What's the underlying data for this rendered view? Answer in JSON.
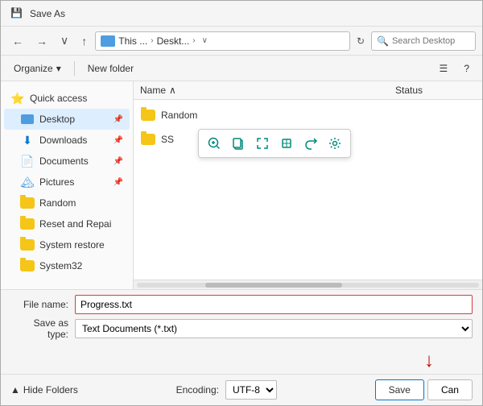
{
  "window": {
    "title": "Save As",
    "icon": "💾"
  },
  "navbar": {
    "back_label": "←",
    "forward_label": "→",
    "down_label": "∨",
    "up_label": "↑",
    "refresh_label": "↻",
    "address_parts": [
      "This ...",
      "Deskt...",
      ">"
    ],
    "search_placeholder": "Search Desktop"
  },
  "toolbar": {
    "organize_label": "Organize",
    "organize_arrow": "▾",
    "new_folder_label": "New folder",
    "view_icon": "☰",
    "help_icon": "?"
  },
  "sidebar": {
    "items": [
      {
        "id": "quick-access",
        "label": "Quick access",
        "icon": "⭐",
        "type": "header"
      },
      {
        "id": "desktop",
        "label": "Desktop",
        "icon": "desktop",
        "type": "item",
        "active": true,
        "pinned": true
      },
      {
        "id": "downloads",
        "label": "Downloads",
        "icon": "download",
        "type": "item",
        "pinned": true
      },
      {
        "id": "documents",
        "label": "Documents",
        "icon": "doc",
        "type": "item",
        "pinned": true
      },
      {
        "id": "pictures",
        "label": "Pictures",
        "icon": "pic",
        "type": "item",
        "pinned": true
      },
      {
        "id": "random",
        "label": "Random",
        "icon": "folder",
        "type": "item"
      },
      {
        "id": "reset",
        "label": "Reset and Repai",
        "icon": "folder",
        "type": "item"
      },
      {
        "id": "system-restore",
        "label": "System restore",
        "icon": "folder",
        "type": "item"
      },
      {
        "id": "system32",
        "label": "System32",
        "icon": "folder",
        "type": "item"
      }
    ]
  },
  "columns": {
    "name": "Name",
    "status": "Status",
    "sort_arrow": "∧"
  },
  "files": [
    {
      "id": "random",
      "name": "Random",
      "type": "folder"
    },
    {
      "id": "ss",
      "name": "SS",
      "type": "folder"
    }
  ],
  "context_toolbar": {
    "buttons": [
      {
        "id": "ctx-zoom-in",
        "icon": "⊕",
        "label": "Zoom in"
      },
      {
        "id": "ctx-copy",
        "icon": "⧉",
        "label": "Copy"
      },
      {
        "id": "ctx-expand",
        "icon": "⤢",
        "label": "Expand"
      },
      {
        "id": "ctx-crop",
        "icon": "⊡",
        "label": "Crop"
      },
      {
        "id": "ctx-share",
        "icon": "⎋",
        "label": "Share"
      },
      {
        "id": "ctx-settings",
        "icon": "⚙",
        "label": "Settings"
      }
    ]
  },
  "form": {
    "filename_label": "File name:",
    "filename_value": "Progress.txt",
    "filetype_label": "Save as type:",
    "filetype_value": "Text Documents (*.txt)"
  },
  "action_bar": {
    "hide_folders_label": "Hide Folders",
    "hide_icon": "▲",
    "encoding_label": "Encoding:",
    "encoding_value": "UTF-8",
    "save_label": "Save",
    "cancel_label": "Can"
  }
}
